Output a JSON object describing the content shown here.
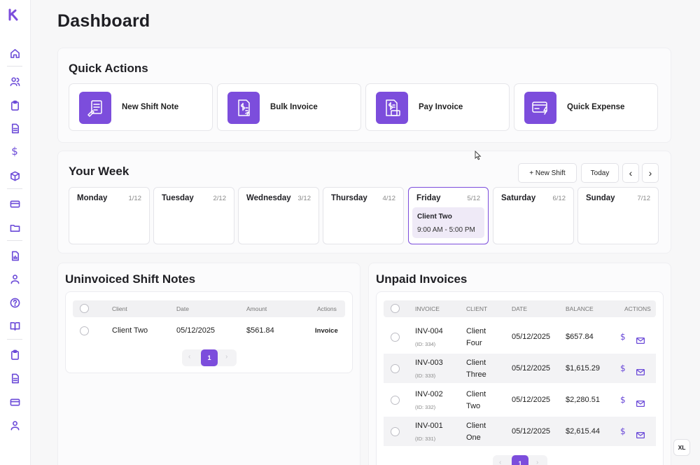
{
  "page": {
    "title": "Dashboard"
  },
  "brand": {
    "accent": "#7c4ddc",
    "logo_letter": "k"
  },
  "sidebar": {
    "icons": [
      "home-icon",
      "users-icon",
      "clipboard-icon",
      "document-icon",
      "dollar-icon",
      "box-icon",
      "card-icon",
      "folder-icon",
      "report-icon",
      "user-icon",
      "help-icon",
      "book-icon",
      "clipboard-icon",
      "document-icon",
      "card-icon",
      "user-icon"
    ],
    "dollar_glyph": "$"
  },
  "quick_actions": {
    "title": "Quick Actions",
    "items": [
      {
        "label": "New Shift Note",
        "icon": "shift-note-icon"
      },
      {
        "label": "Bulk Invoice",
        "icon": "bulk-invoice-icon"
      },
      {
        "label": "Pay Invoice",
        "icon": "pay-invoice-icon"
      },
      {
        "label": "Quick Expense",
        "icon": "quick-expense-icon"
      }
    ]
  },
  "week": {
    "title": "Your Week",
    "new_shift_label": "+ New Shift",
    "today_label": "Today",
    "prev_glyph": "‹",
    "next_glyph": "›",
    "days": [
      {
        "name": "Monday",
        "date": "1/12"
      },
      {
        "name": "Tuesday",
        "date": "2/12"
      },
      {
        "name": "Wednesday",
        "date": "3/12"
      },
      {
        "name": "Thursday",
        "date": "4/12"
      },
      {
        "name": "Friday",
        "date": "5/12",
        "active": true,
        "shift": {
          "client": "Client Two",
          "time": "9:00 AM - 5:00 PM"
        }
      },
      {
        "name": "Saturday",
        "date": "6/12"
      },
      {
        "name": "Sunday",
        "date": "7/12"
      }
    ]
  },
  "uninvoiced": {
    "title": "Uninvoiced Shift Notes",
    "columns": [
      "Client",
      "Date",
      "Amount",
      "Actions"
    ],
    "rows": [
      {
        "client": "Client Two",
        "date": "05/12/2025",
        "amount": "$561.84",
        "action": "Invoice"
      }
    ],
    "pager": {
      "page": "1"
    }
  },
  "unpaid": {
    "title": "Unpaid Invoices",
    "columns": [
      "INVOICE",
      "CLIENT",
      "DATE",
      "BALANCE",
      "ACTIONS"
    ],
    "rows": [
      {
        "invoice": "INV-004",
        "id": "(ID: 334)",
        "client_1": "Client",
        "client_2": "Four",
        "date": "05/12/2025",
        "balance": "$657.84"
      },
      {
        "invoice": "INV-003",
        "id": "(ID: 333)",
        "client_1": "Client",
        "client_2": "Three",
        "date": "05/12/2025",
        "balance": "$1,615.29"
      },
      {
        "invoice": "INV-002",
        "id": "(ID: 332)",
        "client_1": "Client",
        "client_2": "Two",
        "date": "05/12/2025",
        "balance": "$2,280.51"
      },
      {
        "invoice": "INV-001",
        "id": "(ID: 331)",
        "client_1": "Client",
        "client_2": "One",
        "date": "05/12/2025",
        "balance": "$2,615.44"
      }
    ],
    "pager": {
      "page": "1"
    }
  },
  "screen_size_badge": "XL"
}
